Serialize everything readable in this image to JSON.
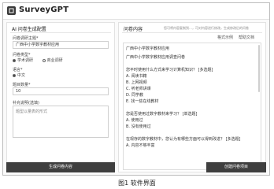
{
  "app": {
    "title": "SurveyGPT"
  },
  "left": {
    "title": "AI 问卷生成配置",
    "topic_label": "问卷调研主题*",
    "topic_value": "广西中小学数字教材应用",
    "type_label": "问卷类型*",
    "type_options": [
      "学术调研",
      "商业调研"
    ],
    "lang_label": "语言*",
    "lang_value": "中文",
    "count_label": "题目数量*",
    "count_value": "10",
    "notes_label": "补充说明(选填)",
    "notes_placeholder": "题型以量表的形式",
    "generate_button": "生成问卷内容"
  },
  "right": {
    "title": "问卷内容",
    "hint": "您可将内容复制到…，可对内容进行修改，生成修改后的问卷",
    "tab_format": "格式示例",
    "tab_help": "帮助文档",
    "lines": [
      "广西中小学数字教材应用",
      "广西中小学数字教材应用调查问卷",
      "您平时使用什么方式来学习计算机知识？ [多选题]",
      "A. 阅读书籍",
      "B. 上网视频",
      "C. 听老师讲课",
      "D. 同学教",
      "E. 找一些在线教材",
      "您是否使用过数字教材来学习？ [单选题]",
      "A. 使用过",
      "B. 没有使用过",
      "在现存的数字教材中，您认为有哪些方面可以得到改进？ [多选题]",
      "A. 内容不够丰富"
    ],
    "create_button": "创建问卷项目"
  },
  "caption": "图1  软件界面"
}
